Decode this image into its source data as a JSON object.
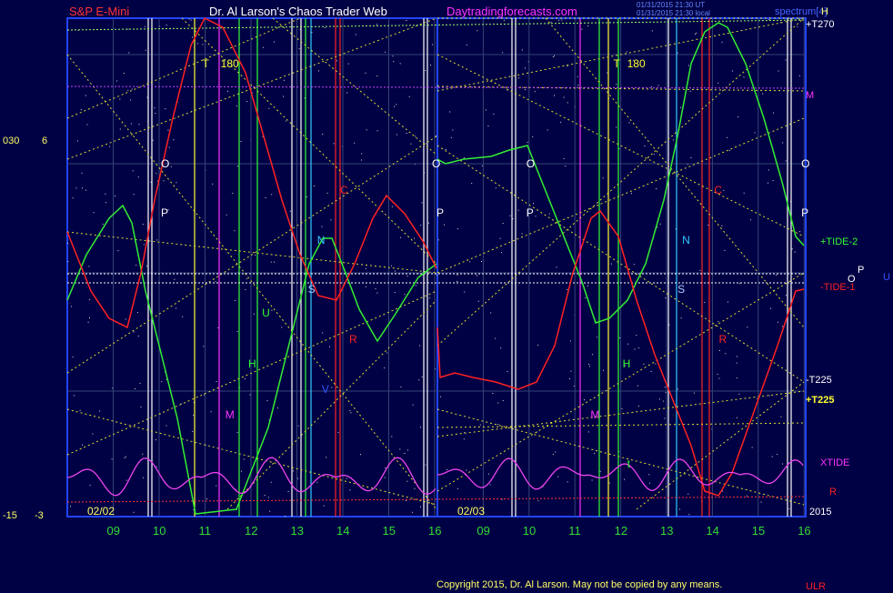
{
  "header": {
    "left_title": "S&P E-Mini",
    "center_title": "Dr. Al Larson's Chaos Trader Web",
    "site": "Daytradingforecasts.com",
    "stamp_line1": "01/31/2015 21:30 UT",
    "stamp_line2": "01/31/2015 21:30 local",
    "spectrum": "spectrum[4]"
  },
  "left_axis": {
    "top_a": "030",
    "top_b": "6",
    "bottom_a": "-15",
    "bottom_b": "-3"
  },
  "right_labels": {
    "h_top": "H",
    "t270": "+T270",
    "m": "M",
    "tide2": "+TIDE-2",
    "o": "O",
    "p": "P",
    "u": "U",
    "tide1": "-TIDE-1",
    "t225a": "-T225",
    "t225b": "+T225",
    "xtide": "XTIDE",
    "r": "R",
    "year": "2015"
  },
  "footer": {
    "copyright": "Copyright 2015, Dr. Al Larson. May not be copied by any means.",
    "ulr": "ULR"
  },
  "chart_data": {
    "type": "line",
    "title": "S&P E-Mini",
    "panels": [
      {
        "date": "02/02",
        "x_ticks": [
          "09",
          "10",
          "11",
          "12",
          "13",
          "14",
          "15",
          "16"
        ],
        "markers": [
          {
            "label": "O",
            "x": 10.0
          },
          {
            "label": "P",
            "x": 10.0
          },
          {
            "label": "T",
            "x": 10.9
          },
          {
            "label": "180",
            "x": 11.3
          },
          {
            "label": "M",
            "x": 11.4
          },
          {
            "label": "U",
            "x": 12.2
          },
          {
            "label": "H",
            "x": 11.9
          },
          {
            "label": "N",
            "x": 13.4
          },
          {
            "label": "S",
            "x": 13.2
          },
          {
            "label": "V",
            "x": 13.5
          },
          {
            "label": "C",
            "x": 13.9
          },
          {
            "label": "R",
            "x": 14.1
          },
          {
            "label": "O",
            "x": 15.9
          },
          {
            "label": "P",
            "x": 16.0
          }
        ]
      },
      {
        "date": "02/03",
        "x_ticks": [
          "09",
          "10",
          "11",
          "12",
          "13",
          "14",
          "15",
          "16"
        ],
        "markers": [
          {
            "label": "O",
            "x": 9.9
          },
          {
            "label": "P",
            "x": 9.9
          },
          {
            "label": "T",
            "x": 11.8
          },
          {
            "label": "180",
            "x": 12.1
          },
          {
            "label": "M",
            "x": 11.3
          },
          {
            "label": "H",
            "x": 12.0
          },
          {
            "label": "t",
            "x": 12.1
          },
          {
            "label": "N",
            "x": 13.3
          },
          {
            "label": "S",
            "x": 13.2
          },
          {
            "label": "C",
            "x": 14.0
          },
          {
            "label": "R",
            "x": 14.1
          },
          {
            "label": "O",
            "x": 15.9
          },
          {
            "label": "P",
            "x": 15.9
          }
        ]
      }
    ],
    "series": [
      {
        "name": "+TIDE-2",
        "color": "#00dd00"
      },
      {
        "name": "-TIDE-1",
        "color": "#ff2222"
      },
      {
        "name": "XTIDE",
        "color": "#ee44ee"
      }
    ]
  }
}
